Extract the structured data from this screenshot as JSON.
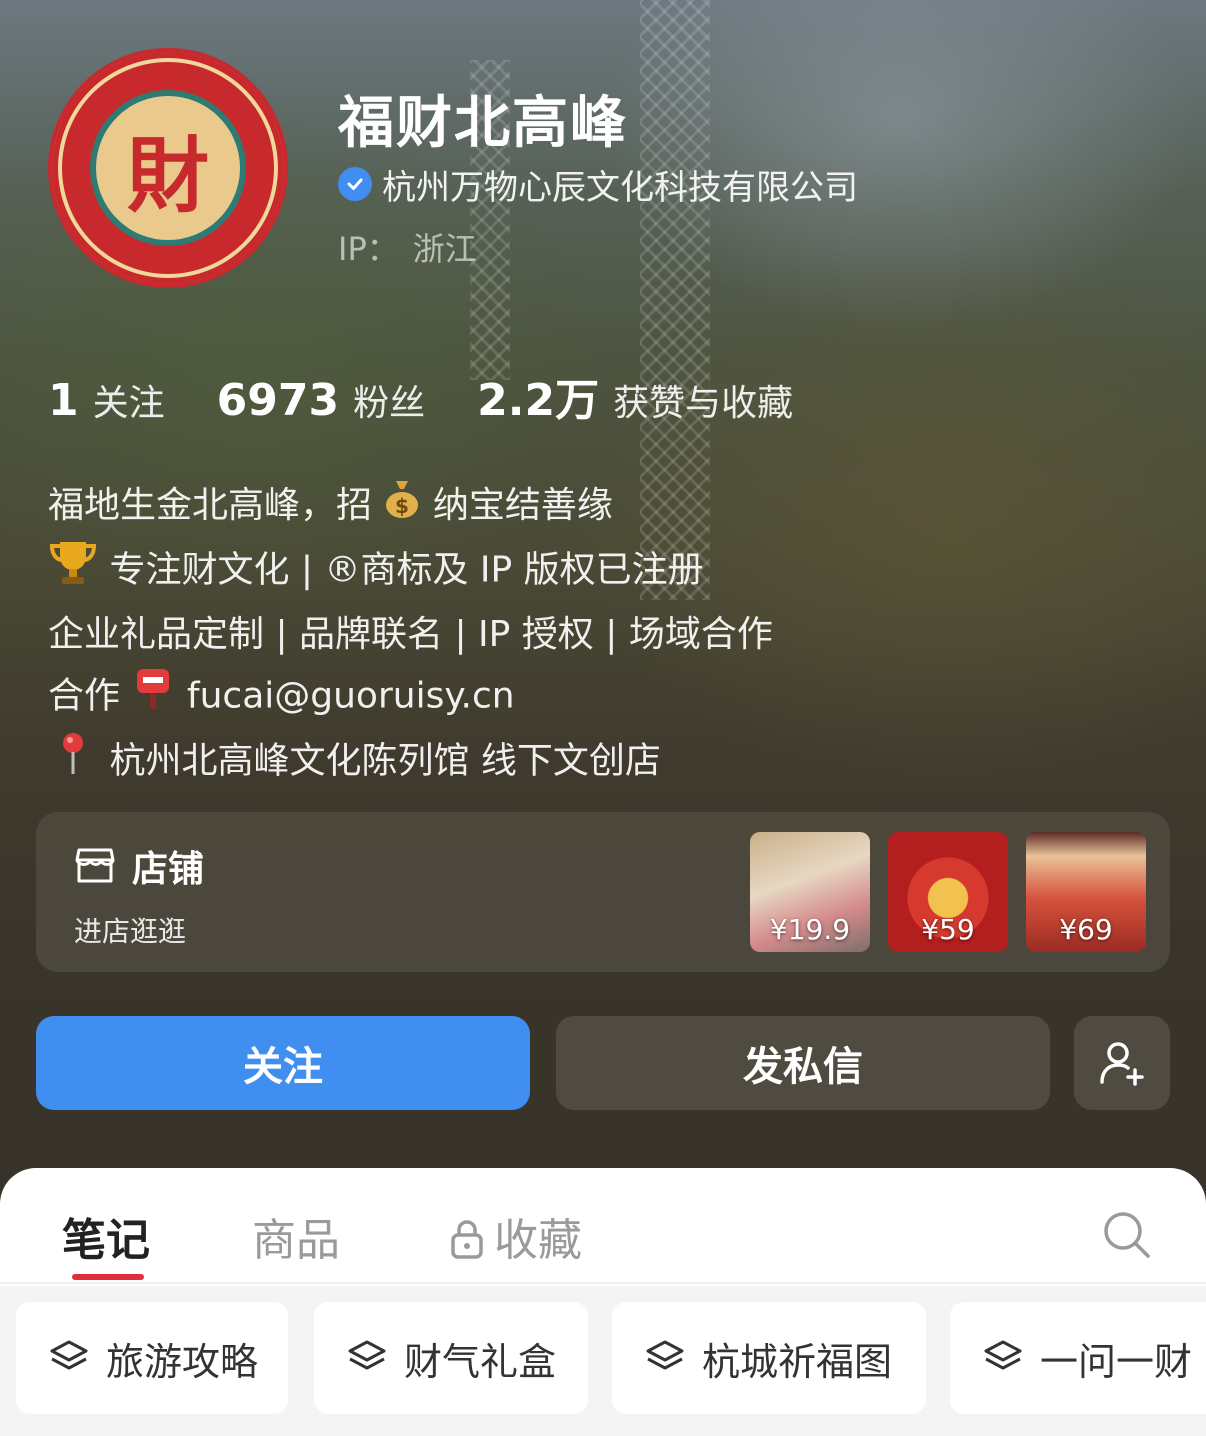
{
  "profile": {
    "name": "福财北高峰",
    "verified_org": "杭州万物心辰文化科技有限公司",
    "ip_label": "IP：",
    "ip_value": "浙江",
    "avatar_glyph": "財"
  },
  "stats": [
    {
      "value": "1",
      "label": "关注"
    },
    {
      "value": "6973",
      "label": "粉丝"
    },
    {
      "value": "2.2万",
      "label": "获赞与收藏"
    }
  ],
  "bio": {
    "line1_a": "福地生金北高峰，招",
    "line1_b": "纳宝结善缘",
    "line2": "专注财文化 | ®商标及 IP 版权已注册",
    "line3": "企业礼品定制 | 品牌联名 | IP 授权 | 场域合作",
    "line4_a": "合作",
    "line4_b": "fucai@guoruisy.cn",
    "line5": "杭州北高峰文化陈列馆 线下文创店"
  },
  "shop": {
    "title": "店铺",
    "subtitle": "进店逛逛",
    "products": [
      {
        "price": "¥19.9"
      },
      {
        "price": "¥59"
      },
      {
        "price": "¥69"
      }
    ]
  },
  "actions": {
    "follow": "关注",
    "message": "发私信"
  },
  "tabs": {
    "notes": "笔记",
    "goods": "商品",
    "collections": "收藏"
  },
  "chips": [
    "旅游攻略",
    "财气礼盒",
    "杭城祈福图",
    "一问一财"
  ],
  "colors": {
    "accent_blue": "#3f8ef0",
    "tab_underline": "#e02e3c",
    "avatar_red": "#c7292d"
  }
}
